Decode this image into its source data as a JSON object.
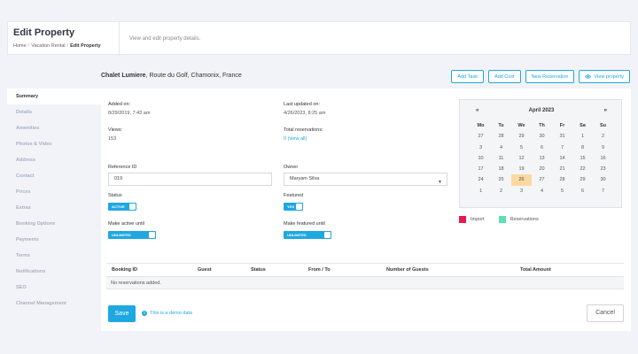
{
  "header": {
    "title": "Edit Property",
    "breadcrumb": [
      "Home",
      "Vacation Rental",
      "Edit Property"
    ],
    "description": "View and edit property details."
  },
  "property": {
    "name": "Chalet Lumiere",
    "address": ", Route du Golf, Chamonix, France"
  },
  "actions": {
    "add_task": "Add Task",
    "add_cost": "Add Cost",
    "new_reservation": "New Reservation",
    "view_property": "View property"
  },
  "sidebar": {
    "items": [
      {
        "label": "Summary"
      },
      {
        "label": "Details"
      },
      {
        "label": "Amenities"
      },
      {
        "label": "Photos & Video"
      },
      {
        "label": "Address"
      },
      {
        "label": "Contact"
      },
      {
        "label": "Prices"
      },
      {
        "label": "Extras"
      },
      {
        "label": "Booking Options"
      },
      {
        "label": "Payments"
      },
      {
        "label": "Terms"
      },
      {
        "label": "Notifications"
      },
      {
        "label": "SEO"
      },
      {
        "label": "Channel Management"
      }
    ]
  },
  "summary": {
    "added_on_label": "Added on:",
    "added_on_value": "8/29/2019, 7:43 am",
    "last_updated_label": "Last updated on:",
    "last_updated_value": "4/26/2023, 8:25 am",
    "views_label": "Views:",
    "views_value": "153",
    "total_reservations_label": "Total reservations:",
    "total_reservations_value": "0 (view all)"
  },
  "form": {
    "reference_id_label": "Reference ID",
    "reference_id_value": "019",
    "owner_label": "Owner",
    "owner_value": "Maryam Silva",
    "status_label": "Status",
    "status_value": "ACTIVE",
    "featured_label": "Featured",
    "featured_value": "YES",
    "active_until_label": "Make active until",
    "active_until_value": "UNLIMITED",
    "featured_until_label": "Make featured until",
    "featured_until_value": "UNLIMITED"
  },
  "calendar": {
    "prev": "«",
    "next": "»",
    "month": "April 2023",
    "weekdays": [
      "Mo",
      "Tu",
      "We",
      "Th",
      "Fr",
      "Sa",
      "Su"
    ],
    "days": [
      "27",
      "28",
      "29",
      "30",
      "31",
      "1",
      "2",
      "3",
      "4",
      "5",
      "6",
      "7",
      "8",
      "9",
      "10",
      "11",
      "12",
      "13",
      "14",
      "15",
      "16",
      "17",
      "18",
      "19",
      "20",
      "21",
      "22",
      "23",
      "24",
      "25",
      "26",
      "27",
      "28",
      "29",
      "30",
      "1",
      "2",
      "3",
      "4",
      "5",
      "6",
      "7"
    ],
    "today": "26",
    "legend": [
      {
        "label": "Import",
        "color": "#e8194f"
      },
      {
        "label": "Reservations",
        "color": "#5de0b0"
      }
    ]
  },
  "table": {
    "headers": [
      "Booking ID",
      "Guest",
      "Status",
      "From / To",
      "Number of Guests",
      "Total Amount"
    ],
    "empty_message": "No reservations added."
  },
  "footer": {
    "save": "Save",
    "demo_note": "This is a demo data",
    "cancel": "Cancel"
  },
  "colors": {
    "accent": "#1fa8e0",
    "today_highlight": "#fbd9a0"
  }
}
